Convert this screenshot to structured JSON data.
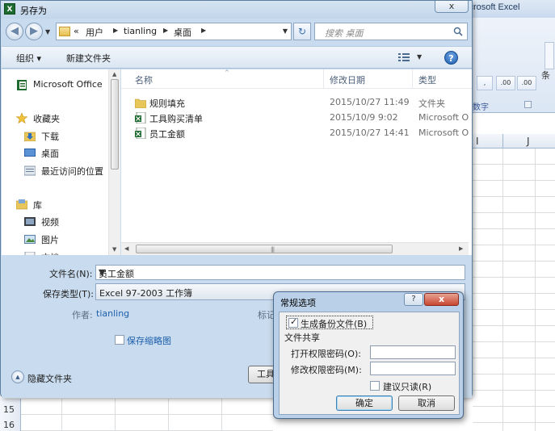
{
  "excel": {
    "title": "icrosoft Excel",
    "ribbon_buttons": [
      ",",
      ".00",
      ".00"
    ],
    "ribbon_group": "数字",
    "ribbon_partial": "条",
    "columns": [
      "I",
      "J"
    ],
    "rows": [
      "15",
      "16"
    ]
  },
  "dialog": {
    "title": "另存为",
    "close_label": "x",
    "app_icon": "X",
    "breadcrumb": [
      "用户",
      "tianling",
      "桌面"
    ],
    "breadcrumb_prefix": "«",
    "search_placeholder": "搜索 桌面",
    "toolbar": {
      "organize": "组织 ▾",
      "new_folder": "新建文件夹",
      "help": "?"
    },
    "nav": [
      {
        "label": "Microsoft Office",
        "icon": "office-icon"
      },
      {
        "label": "收藏夹",
        "icon": "star-icon"
      },
      {
        "label": "下载",
        "icon": "download-folder-icon"
      },
      {
        "label": "桌面",
        "icon": "desktop-icon"
      },
      {
        "label": "最近访问的位置",
        "icon": "recent-places-icon"
      },
      {
        "label": "库",
        "icon": "library-icon"
      },
      {
        "label": "视频",
        "icon": "video-icon"
      },
      {
        "label": "图片",
        "icon": "pictures-icon"
      },
      {
        "label": "文档",
        "icon": "documents-icon"
      }
    ],
    "file_columns": {
      "name": "名称",
      "modified": "修改日期",
      "type": "类型"
    },
    "files": [
      {
        "name": "规则填充",
        "modified": "2015/10/27 11:49",
        "type": "文件夹",
        "icon": "folder-icon"
      },
      {
        "name": "工具购买清单",
        "modified": "2015/10/9 9:02",
        "type": "Microsoft O",
        "icon": "excel-file-icon"
      },
      {
        "name": "员工金额",
        "modified": "2015/10/27 14:41",
        "type": "Microsoft O",
        "icon": "excel-file-icon"
      }
    ],
    "form": {
      "filename_label": "文件名(N):",
      "filename_value": "员工金额",
      "type_label": "保存类型(T):",
      "type_value": "Excel 97-2003 工作簿",
      "author_label": "作者:",
      "author_value": "tianling",
      "tags_label": "标记",
      "thumbnail_label": "保存缩略图",
      "hide_folders": "隐藏文件夹",
      "tools_button": "工具"
    }
  },
  "general_options": {
    "title": "常规选项",
    "help": "?",
    "close": "x",
    "backup_label": "生成备份文件(B)",
    "backup_checked": true,
    "sharing_heading": "文件共享",
    "open_password_label": "打开权限密码(O):",
    "open_password_value": "",
    "modify_password_label": "修改权限密码(M):",
    "modify_password_value": "",
    "readonly_label": "建议只读(R)",
    "readonly_checked": false,
    "ok": "确定",
    "cancel": "取消"
  }
}
